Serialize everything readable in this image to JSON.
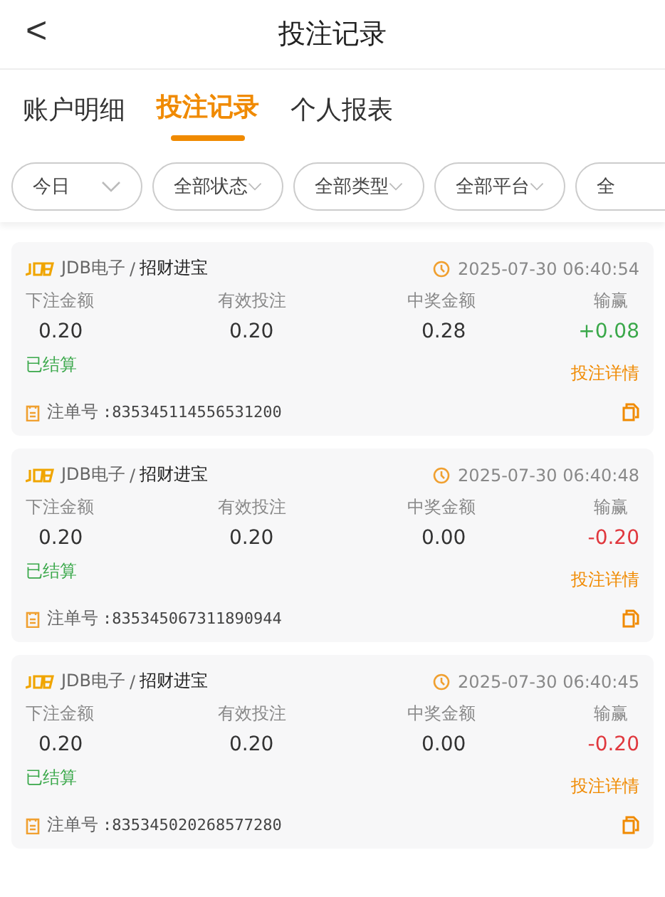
{
  "header": {
    "back": "<",
    "title": "投注记录"
  },
  "tabs": [
    {
      "label": "账户明细",
      "selected": false
    },
    {
      "label": "投注记录",
      "selected": true
    },
    {
      "label": "个人报表",
      "selected": false
    }
  ],
  "filters": [
    {
      "label": "今日"
    },
    {
      "label": "全部状态"
    },
    {
      "label": "全部类型"
    },
    {
      "label": "全部平台"
    },
    {
      "label": "全"
    }
  ],
  "records": [
    {
      "provider": "JDB电子",
      "game": "招财进宝",
      "separator": "/",
      "time": "2025-07-30 06:40:54",
      "columns": [
        {
          "label": "下注金额",
          "value": "0.20"
        },
        {
          "label": "有效投注",
          "value": "0.20"
        },
        {
          "label": "中奖金额",
          "value": "0.28"
        },
        {
          "label": "输赢",
          "value": "+0.08"
        }
      ],
      "won": true,
      "status": "已结算",
      "detail_link": "投注详情",
      "order_label": "注单号",
      "order_no": ":835345114556531200"
    },
    {
      "provider": "JDB电子",
      "game": "招财进宝",
      "separator": "/",
      "time": "2025-07-30 06:40:48",
      "columns": [
        {
          "label": "下注金额",
          "value": "0.20"
        },
        {
          "label": "有效投注",
          "value": "0.20"
        },
        {
          "label": "中奖金额",
          "value": "0.00"
        },
        {
          "label": "输赢",
          "value": "-0.20"
        }
      ],
      "won": false,
      "status": "已结算",
      "detail_link": "投注详情",
      "order_label": "注单号",
      "order_no": ":835345067311890944"
    },
    {
      "provider": "JDB电子",
      "game": "招财进宝",
      "separator": "/",
      "time": "2025-07-30 06:40:45",
      "columns": [
        {
          "label": "下注金额",
          "value": "0.20"
        },
        {
          "label": "有效投注",
          "value": "0.20"
        },
        {
          "label": "中奖金额",
          "value": "0.00"
        },
        {
          "label": "输赢",
          "value": "-0.20"
        }
      ],
      "won": false,
      "status": "已结算",
      "detail_link": "投注详情",
      "order_label": "注单号",
      "order_no": ":835345020268577280"
    }
  ]
}
